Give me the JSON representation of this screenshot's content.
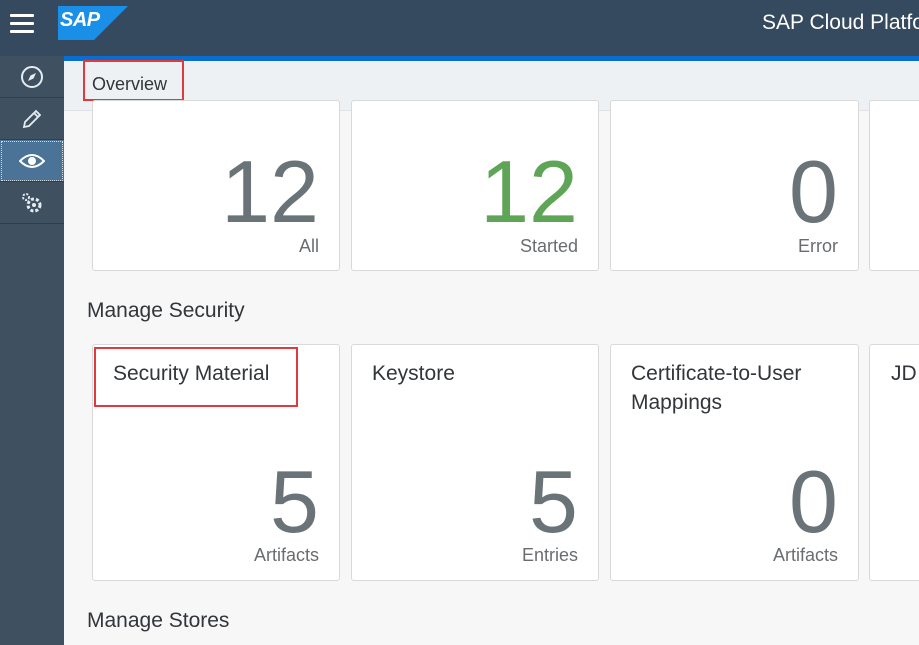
{
  "header": {
    "logo": "SAP",
    "title": "SAP Cloud Platform"
  },
  "sidebar": {
    "items": [
      {
        "icon": "compass-icon",
        "label": "Discover"
      },
      {
        "icon": "pencil-icon",
        "label": "Design"
      },
      {
        "icon": "eye-icon",
        "label": "Monitor",
        "active": true
      },
      {
        "icon": "gears-icon",
        "label": "Settings"
      }
    ]
  },
  "subheader": {
    "title": "Overview"
  },
  "overview": {
    "tiles": [
      {
        "number": "12",
        "unit": "All"
      },
      {
        "number": "12",
        "unit": "Started",
        "color": "#5fa557"
      },
      {
        "number": "0",
        "unit": "Error"
      }
    ]
  },
  "manage_security": {
    "title": "Manage Security",
    "tiles": [
      {
        "title": "Security Material",
        "number": "5",
        "unit": "Artifacts"
      },
      {
        "title": "Keystore",
        "number": "5",
        "unit": "Entries"
      },
      {
        "title_line1": "Certificate-to-User",
        "title_line2": "Mappings",
        "number": "0",
        "unit": "Artifacts"
      },
      {
        "title": "JD"
      }
    ]
  },
  "manage_stores": {
    "title": "Manage Stores"
  },
  "colors": {
    "header": "#354a5f",
    "accent": "#0a6ed1",
    "started": "#5fa557",
    "highlight": "#e03a3e"
  }
}
